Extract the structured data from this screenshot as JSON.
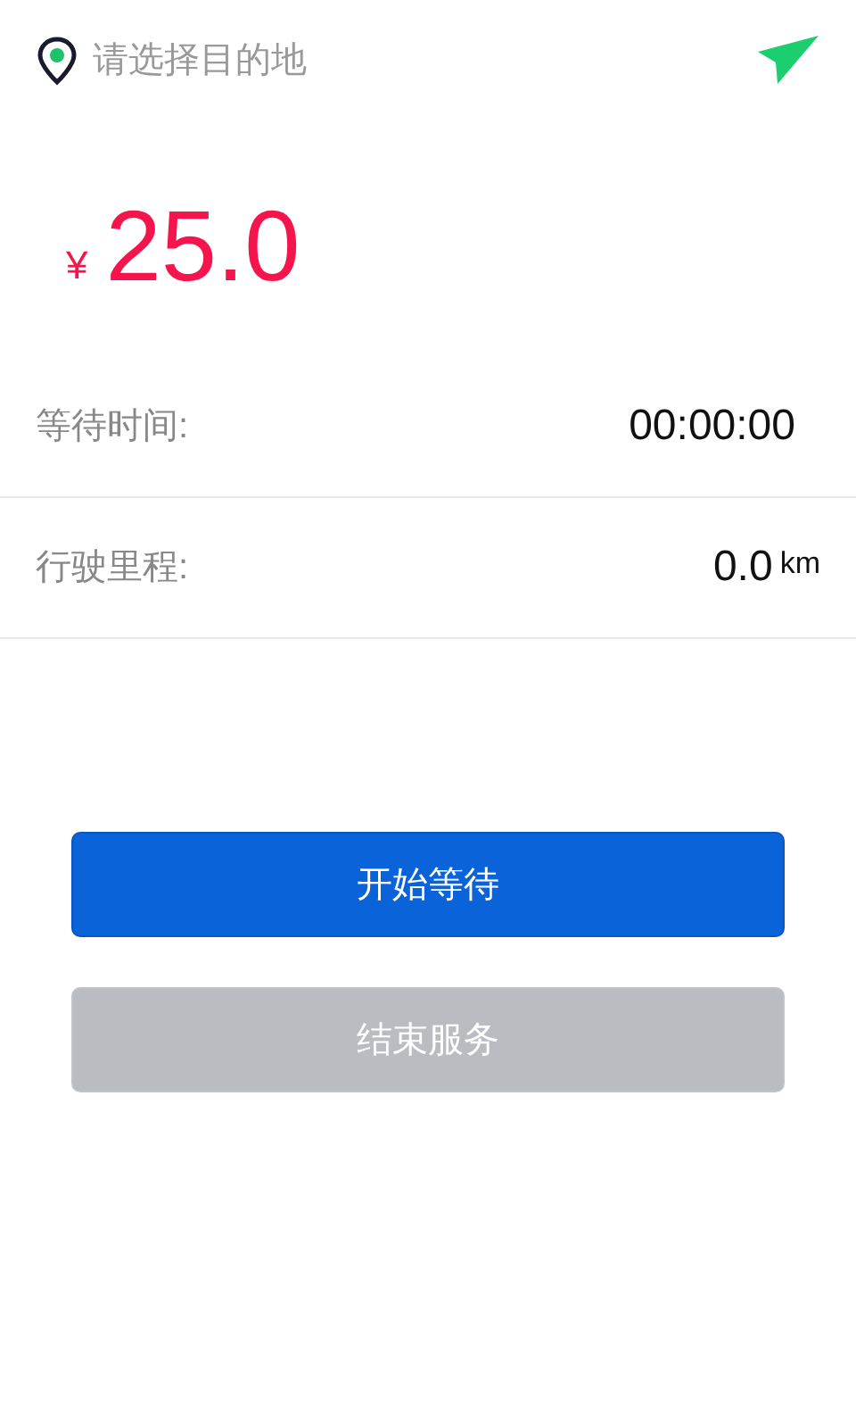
{
  "destination": {
    "placeholder": "请选择目的地"
  },
  "fare": {
    "currency": "¥",
    "amount": "25.0"
  },
  "stats": [
    {
      "label": "等待时间:",
      "value": "00:00:00"
    },
    {
      "label": "行驶里程:",
      "value": "0.0",
      "unit": "km"
    }
  ],
  "buttons": [
    {
      "label": "开始等待",
      "disabled": false
    },
    {
      "label": "结束服务",
      "disabled": true
    }
  ]
}
